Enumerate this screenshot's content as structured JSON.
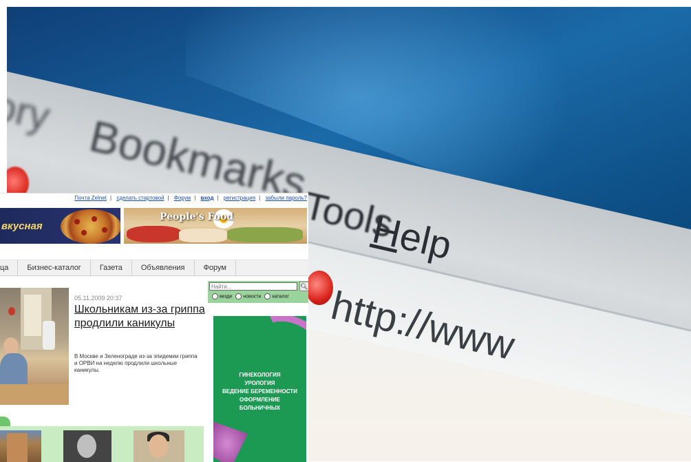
{
  "background": {
    "menu_words": {
      "history": "ory",
      "bookmarks": "Bookmarks",
      "tools": "Tools",
      "help": "Help"
    },
    "address_text": "http://www"
  },
  "site": {
    "top_links": [
      {
        "label": "Почта Zelnet"
      },
      {
        "label": "сделать стартовой"
      },
      {
        "label": "Форум"
      },
      {
        "label": "вход"
      },
      {
        "label": "регистрация"
      },
      {
        "label": "забыли пароль?"
      }
    ],
    "banner_left_text": "вкусная",
    "banner_right_logo": "People's    Food",
    "nav": [
      "ца",
      "Бизнес-каталог",
      "Газета",
      "Объявления",
      "Форум"
    ],
    "news": {
      "date": "05.11.2009 20:37",
      "title": "Школьникам из-за гриппа продлили каникулы",
      "body": "В Москве и Зеленограде из-за эпидемии гриппа и ОРВИ на неделю продлили школьные каникулы."
    },
    "search": {
      "placeholder": "Найти...",
      "options": [
        "везде",
        "новости",
        "каталог"
      ]
    },
    "ad_lines": [
      "ГИНЕКОЛОГИЯ",
      "УРОЛОГИЯ",
      "ВЕДЕНИЕ БЕРЕМЕННОСТИ",
      "ОФОРМЛЕНИЕ",
      "БОЛЬНИЧНЫХ"
    ]
  },
  "colors": {
    "nav_bg": "#f1f1f1",
    "search_bg": "#9bd39c",
    "ad_bg": "#1c9a54",
    "link": "#1f4fa8"
  }
}
